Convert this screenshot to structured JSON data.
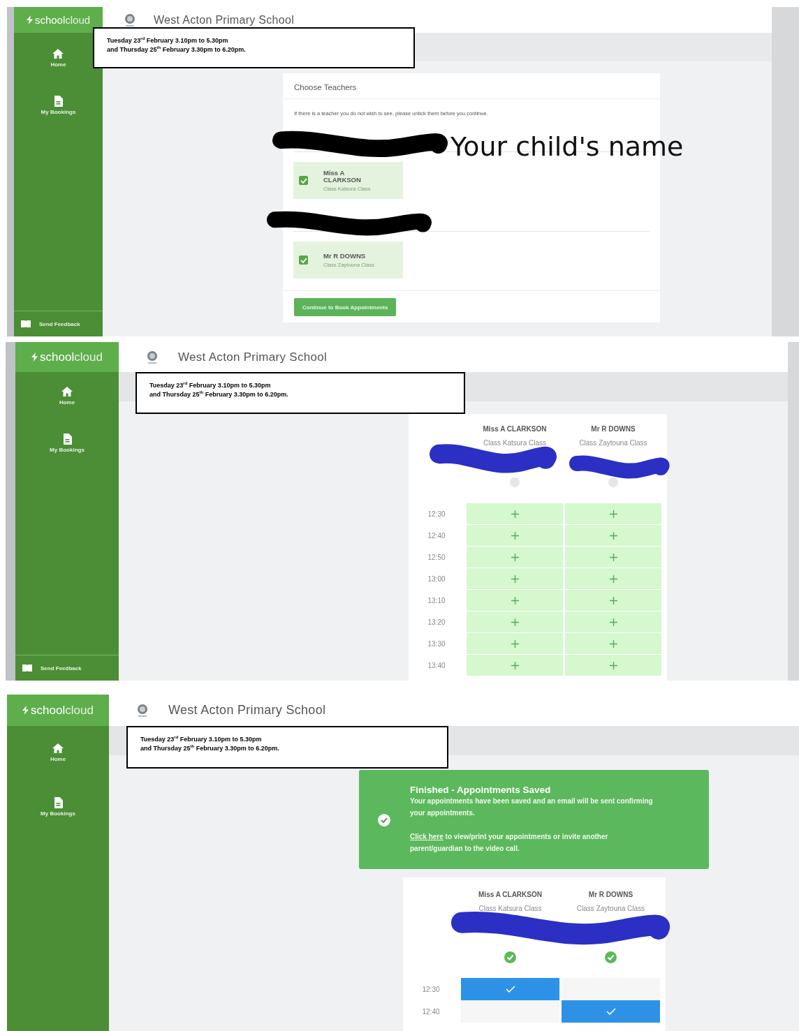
{
  "panels": [
    {
      "kind": "choose_teachers",
      "logo": "**school**cloud",
      "school_name": "West Acton Primary School",
      "nav": [
        {
          "label": "Home"
        },
        {
          "label": "My Bookings"
        }
      ],
      "feedback": "Send Feedback",
      "note": [
        "Tuesday 23$^{rd}$ February 3.10pm to 5.30pm",
        "and Thursday 25$^{th}$ February 3.30pm to 6.20pm."
      ],
      "card": {
        "title": "Choose Teachers",
        "instruction": "If there is a teacher you do not wish to see, please untick them before you continue.",
        "groups": [
          {
            "teachers": [
              {
                "name": "Miss A CLARKSON",
                "class": "Class Katsura Class",
                "checked": true
              }
            ]
          },
          {
            "teachers": [
              {
                "name": "Mr R DOWNS",
                "class": "Class Zaytouna Class",
                "checked": true
              }
            ]
          }
        ],
        "button": "Continue to Book Appointments"
      },
      "annotation": "Your child's name"
    },
    {
      "kind": "schedule",
      "logo": "**school**cloud",
      "school_name": "West Acton Primary School",
      "nav": [
        {
          "label": "Home"
        },
        {
          "label": "My Bookings"
        }
      ],
      "feedback": "Send Feedback",
      "note": [
        "Tuesday 23$^{rd}$ February 3.10pm to 5.30pm",
        "and Thursday 25$^{th}$ February 3.30pm to 6.20pm."
      ],
      "card": {
        "teachers": [
          {
            "name": "Miss A CLARKSON",
            "class": "Class Katsura Class",
            "booked": false
          },
          {
            "name": "Mr R DOWNS",
            "class": "Class Zaytouna Class",
            "booked": false
          }
        ],
        "rows": [
          {
            "time": "12:30",
            "slots": [
              {
                "kind": "available"
              },
              {
                "kind": "available"
              }
            ]
          },
          {
            "time": "12:40",
            "slots": [
              {
                "kind": "available"
              },
              {
                "kind": "available"
              }
            ]
          },
          {
            "time": "12:50",
            "slots": [
              {
                "kind": "available"
              },
              {
                "kind": "available"
              }
            ]
          },
          {
            "time": "13:00",
            "slots": [
              {
                "kind": "available"
              },
              {
                "kind": "available"
              }
            ]
          },
          {
            "time": "13:10",
            "slots": [
              {
                "kind": "available"
              },
              {
                "kind": "available"
              }
            ]
          },
          {
            "time": "13:20",
            "slots": [
              {
                "kind": "available"
              },
              {
                "kind": "available"
              }
            ]
          },
          {
            "time": "13:30",
            "slots": [
              {
                "kind": "available"
              },
              {
                "kind": "available"
              }
            ]
          },
          {
            "time": "13:40",
            "slots": [
              {
                "kind": "available"
              },
              {
                "kind": "available"
              }
            ]
          }
        ]
      }
    },
    {
      "kind": "saved",
      "logo": "**school**cloud",
      "school_name": "West Acton Primary School",
      "nav": [
        {
          "label": "Home"
        },
        {
          "label": "My Bookings"
        }
      ],
      "note": [
        "Tuesday 23$^{rd}$ February 3.10pm to 5.30pm",
        "and Thursday 25$^{th}$ February 3.30pm to 6.20pm."
      ],
      "alert": {
        "title": "Finished - Appointments Saved",
        "message": "Your appointments have been saved and an email will be sent confirming your appointments.",
        "link": "Click here",
        "link_rest": " to view/print your appointments or invite another parent/guardian to the video call."
      },
      "card": {
        "teachers": [
          {
            "name": "Miss A CLARKSON",
            "class": "Class Katsura Class",
            "booked": true
          },
          {
            "name": "Mr R DOWNS",
            "class": "Class Zaytouna Class",
            "booked": true
          }
        ],
        "rows": [
          {
            "time": "12:30",
            "slots": [
              {
                "kind": "booked"
              },
              {
                "kind": "empty"
              }
            ]
          },
          {
            "time": "12:40",
            "slots": [
              {
                "kind": "empty"
              },
              {
                "kind": "booked"
              }
            ]
          }
        ]
      }
    }
  ]
}
